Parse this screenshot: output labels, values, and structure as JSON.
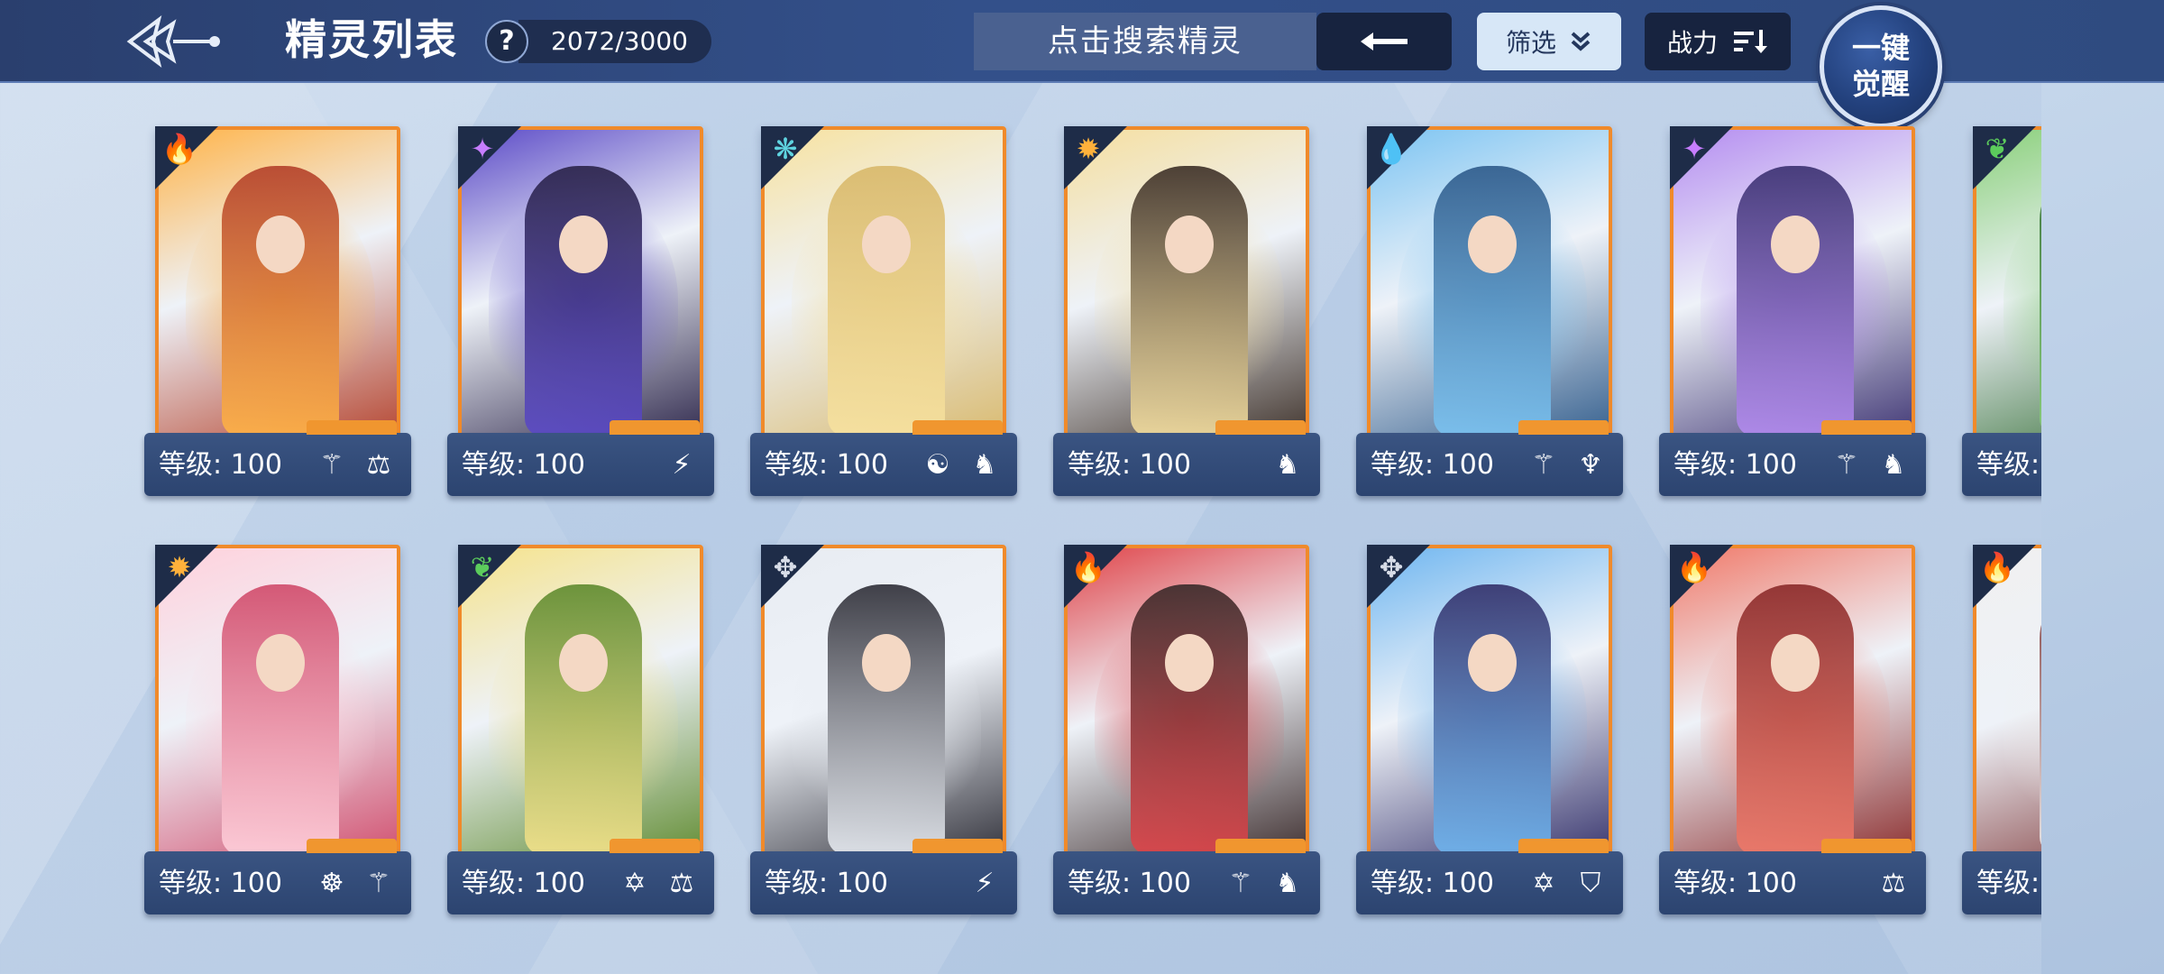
{
  "header": {
    "title": "精灵列表",
    "help_label": "?",
    "count": "2072/3000",
    "search_placeholder": "点击搜索精灵",
    "filter_label": "筛选",
    "sort_label": "战力",
    "awaken_line1": "一键",
    "awaken_line2": "觉醒"
  },
  "colors": {
    "frame_orange": "#f08a2a",
    "bar_dark": "#2a3f6e",
    "filter_bg": "#d7e7f7"
  },
  "cards": [
    {
      "level": "等级: 100",
      "element": "fire-icon",
      "element_glyph": "🔥",
      "element_color": "#ff5a4a",
      "traits": [
        "⚚",
        "⚖"
      ],
      "art": [
        "#ffb347",
        "#b3402a"
      ]
    },
    {
      "level": "等级: 100",
      "element": "shadow-icon",
      "element_glyph": "✦",
      "element_color": "#c77dff",
      "traits": [
        "⚡"
      ],
      "art": [
        "#5b4ac7",
        "#2a2348"
      ]
    },
    {
      "level": "等级: 100",
      "element": "light-icon",
      "element_glyph": "❋",
      "element_color": "#5fd3e0",
      "traits": [
        "☯",
        "♞"
      ],
      "art": [
        "#f7e2a0",
        "#d8b86a"
      ]
    },
    {
      "level": "等级: 100",
      "element": "sun-icon",
      "element_glyph": "✹",
      "element_color": "#ffb13b",
      "traits": [
        "♞"
      ],
      "art": [
        "#f5dfa0",
        "#3b2e26"
      ]
    },
    {
      "level": "等级: 100",
      "element": "water-icon",
      "element_glyph": "💧",
      "element_color": "#4aa6ff",
      "traits": [
        "⚚",
        "♆"
      ],
      "art": [
        "#7cc4f2",
        "#2e5a8a"
      ]
    },
    {
      "level": "等级: 100",
      "element": "shadow-icon",
      "element_glyph": "✦",
      "element_color": "#c77dff",
      "traits": [
        "⚚",
        "♞"
      ],
      "art": [
        "#b48cf0",
        "#3a3070"
      ]
    },
    {
      "level": "等级: ",
      "element": "grass-icon",
      "element_glyph": "❦",
      "element_color": "#5ccc5c",
      "traits": [],
      "art": [
        "#8ad07a",
        "#2f6a2f"
      ]
    },
    {
      "level": "等级: 100",
      "element": "sun-icon",
      "element_glyph": "✹",
      "element_color": "#ffb13b",
      "traits": [
        "☸",
        "⚚"
      ],
      "art": [
        "#ffd1dc",
        "#d04a6a"
      ]
    },
    {
      "level": "等级: 100",
      "element": "grass-icon",
      "element_glyph": "❦",
      "element_color": "#5ccc5c",
      "traits": [
        "✡",
        "⚖"
      ],
      "art": [
        "#f5e38c",
        "#5e8a2e"
      ]
    },
    {
      "level": "等级: 100",
      "element": "mech-icon",
      "element_glyph": "✥",
      "element_color": "#d8dde8",
      "traits": [
        "⚡"
      ],
      "art": [
        "#e8ecf2",
        "#2d2d36"
      ]
    },
    {
      "level": "等级: 100",
      "element": "fire-icon",
      "element_glyph": "🔥",
      "element_color": "#ff5a4a",
      "traits": [
        "⚚",
        "♞"
      ],
      "art": [
        "#e0454a",
        "#3a2a2a"
      ]
    },
    {
      "level": "等级: 100",
      "element": "mech-icon",
      "element_glyph": "✥",
      "element_color": "#d8dde8",
      "traits": [
        "✡",
        "⛉"
      ],
      "art": [
        "#6fb6f0",
        "#33306a"
      ]
    },
    {
      "level": "等级: 100",
      "element": "fire-icon",
      "element_glyph": "🔥",
      "element_color": "#ff5a4a",
      "traits": [
        "⚖"
      ],
      "art": [
        "#f07a6a",
        "#8a2a2a"
      ]
    },
    {
      "level": "等级: ",
      "element": "fire-icon",
      "element_glyph": "🔥",
      "element_color": "#ff5a4a",
      "traits": [],
      "art": [
        "#f0f0f0",
        "#7a3030"
      ]
    }
  ]
}
